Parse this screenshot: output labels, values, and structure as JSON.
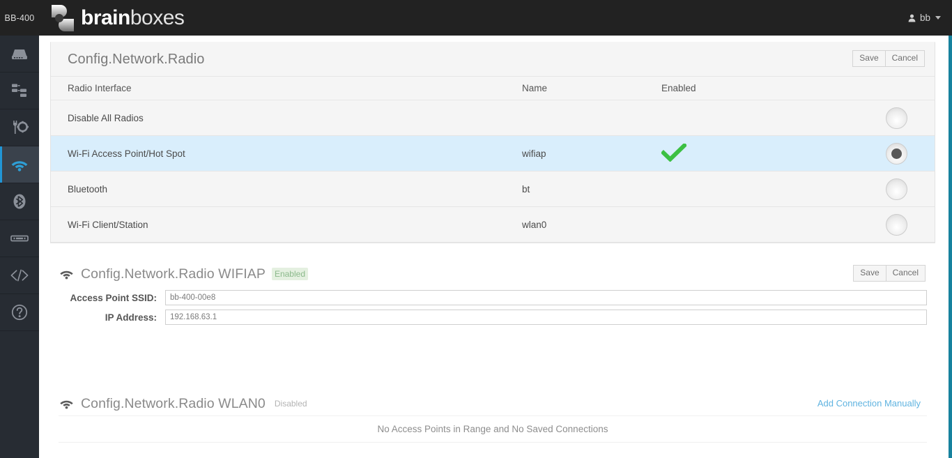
{
  "topbar": {
    "device_label": "BB-400",
    "brand_bold": "brain",
    "brand_light": "boxes",
    "user_icon": "user-icon",
    "user_name": "bb",
    "caret_icon": "chevron-down-icon"
  },
  "sidebar": {
    "items": [
      {
        "icon": "device-icon",
        "name": "sidebar-item-device",
        "active": false
      },
      {
        "icon": "network-icon",
        "name": "sidebar-item-network",
        "active": false
      },
      {
        "icon": "tools-icon",
        "name": "sidebar-item-tools",
        "active": false
      },
      {
        "icon": "wifi-icon",
        "name": "sidebar-item-wifi",
        "active": true
      },
      {
        "icon": "bluetooth-icon",
        "name": "sidebar-item-bluetooth",
        "active": false
      },
      {
        "icon": "serial-icon",
        "name": "sidebar-item-serial",
        "active": false
      },
      {
        "icon": "code-icon",
        "name": "sidebar-item-code",
        "active": false
      },
      {
        "icon": "help-icon",
        "name": "sidebar-item-help",
        "active": false
      }
    ]
  },
  "radio_panel": {
    "title": "Config.Network.Radio",
    "save_label": "Save",
    "cancel_label": "Cancel",
    "columns": [
      "Radio Interface",
      "Name",
      "Enabled"
    ],
    "rows": [
      {
        "interface": "Disable All Radios",
        "name": "",
        "enabled": false,
        "selected": false
      },
      {
        "interface": "Wi-Fi Access Point/Hot Spot",
        "name": "wifiap",
        "enabled": true,
        "selected": true
      },
      {
        "interface": "Bluetooth",
        "name": "bt",
        "enabled": false,
        "selected": false
      },
      {
        "interface": "Wi-Fi Client/Station",
        "name": "wlan0",
        "enabled": false,
        "selected": false
      }
    ]
  },
  "wifiap_section": {
    "icon": "wifi-icon",
    "title": "Config.Network.Radio WIFIAP",
    "status": "Enabled",
    "save_label": "Save",
    "cancel_label": "Cancel",
    "fields": [
      {
        "label": "Access Point SSID:",
        "value": "bb-400-00e8",
        "name": "ssid-field"
      },
      {
        "label": "IP Address:",
        "value": "192.168.63.1",
        "name": "ip-address-field"
      }
    ]
  },
  "wlan0_section": {
    "icon": "wifi-icon",
    "title": "Config.Network.Radio WLAN0",
    "status": "Disabled",
    "add_link": "Add Connection Manually",
    "empty_message": "No Access Points in Range and No Saved Connections"
  },
  "colors": {
    "topbar_bg": "#222222",
    "sidebar_bg": "#272c33",
    "sidebar_active_bg": "#3a424c",
    "accent_blue": "#2196d6",
    "row_selected_bg": "#d9eefc",
    "tick_green": "#3cc043",
    "badge_enabled_bg": "#e4f0e0",
    "link_blue": "#5fb3e0",
    "scrollbar_teal": "#17829e"
  }
}
